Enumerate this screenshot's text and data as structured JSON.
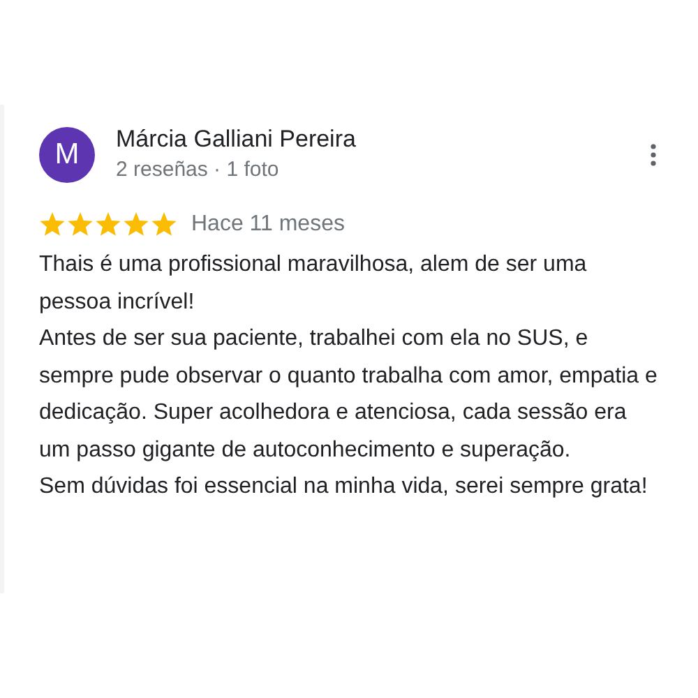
{
  "review": {
    "avatar_letter": "M",
    "author": "Márcia Galliani Pereira",
    "meta": "2 reseñas · 1 foto",
    "stars": 5,
    "time": "Hace 11 meses",
    "paragraphs": [
      "Thais é uma profissional maravilhosa, alem de ser uma pessoa incrível!",
      "Antes de ser sua paciente, trabalhei com ela no SUS, e sempre pude observar o quanto trabalha com amor, empatia e dedicação. Super acolhedora e atenciosa, cada sessão era um passo gigante de autoconhecimento e superação.",
      "Sem dúvidas foi essencial na minha vida, serei sempre grata!"
    ]
  }
}
